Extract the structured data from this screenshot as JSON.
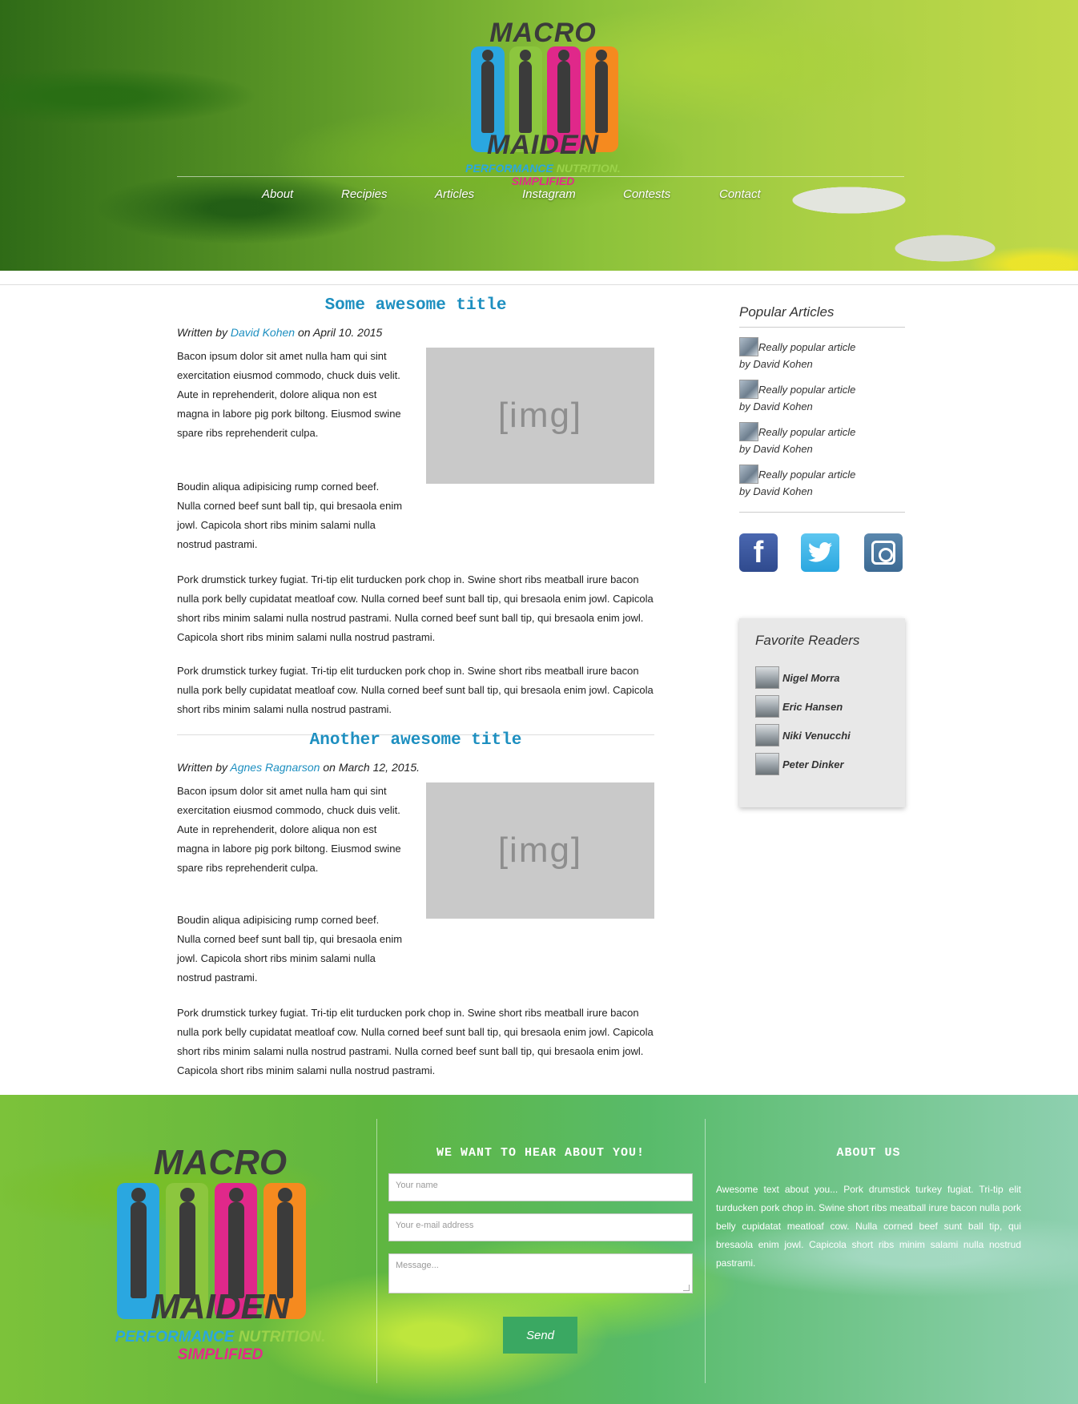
{
  "header": {
    "logo": {
      "word1": "MACRO",
      "word2": "MAIDEN",
      "tag1": "PERFORMANCE",
      "tag2": "NUTRITION.",
      "tag3": "SIMPLIFIED"
    },
    "nav": [
      "About",
      "Recipies",
      "Articles",
      "Instagram",
      "Contests",
      "Contact"
    ]
  },
  "articles": [
    {
      "title": "Some awesome title",
      "written_by": "Written by",
      "author": "David Kohen",
      "date": "on April 10. 2015",
      "img_label": "[img]",
      "para1": "Bacon ipsum dolor sit amet nulla ham qui sint exercitation eiusmod commodo, chuck duis velit. Aute in reprehenderit, dolore aliqua non est magna in labore pig pork biltong. Eiusmod swine spare ribs reprehenderit culpa.",
      "para2": "Boudin aliqua adipisicing rump corned beef. Nulla corned beef sunt ball tip, qui bresaola enim jowl. Capicola short ribs minim salami nulla nostrud pastrami.",
      "para3": "Pork drumstick turkey fugiat. Tri-tip elit turducken pork chop in. Swine short ribs meatball irure bacon nulla pork belly cupidatat meatloaf cow. Nulla corned beef sunt ball tip, qui bresaola enim jowl. Capicola short ribs minim salami nulla nostrud pastrami. Nulla corned beef sunt ball tip, qui bresaola enim jowl. Capicola short ribs minim salami nulla nostrud pastrami.",
      "para4": "Pork drumstick turkey fugiat. Tri-tip elit turducken pork chop in. Swine short ribs meatball irure bacon nulla pork belly cupidatat meatloaf cow. Nulla corned beef sunt ball tip, qui bresaola enim jowl. Capicola short ribs minim salami nulla nostrud pastrami."
    },
    {
      "title": "Another awesome title",
      "written_by": "Written by",
      "author": "Agnes Ragnarson",
      "date": "on March 12, 2015.",
      "img_label": "[img]",
      "para1": "Bacon ipsum dolor sit amet nulla ham qui sint exercitation eiusmod commodo, chuck duis velit. Aute in reprehenderit, dolore aliqua non est magna in labore pig pork biltong. Eiusmod swine spare ribs reprehenderit culpa.",
      "para2": "Boudin aliqua adipisicing rump corned beef. Nulla corned beef sunt ball tip, qui bresaola enim jowl. Capicola short ribs minim salami nulla nostrud pastrami.",
      "para3": "Pork drumstick turkey fugiat. Tri-tip elit turducken pork chop in. Swine short ribs meatball irure bacon nulla pork belly cupidatat meatloaf cow. Nulla corned beef sunt ball tip, qui bresaola enim jowl. Capicola short ribs minim salami nulla nostrud pastrami. Nulla corned beef sunt ball tip, qui bresaola enim jowl. Capicola short ribs minim salami nulla nostrud pastrami."
    }
  ],
  "sidebar": {
    "popular_heading": "Popular Articles",
    "popular": [
      {
        "title": "Really popular article",
        "by": "by David Kohen"
      },
      {
        "title": "Really popular article",
        "by": "by David Kohen"
      },
      {
        "title": "Really popular article",
        "by": "by David Kohen"
      },
      {
        "title": "Really popular article",
        "by": "by David Kohen"
      }
    ],
    "socials": [
      {
        "name": "facebook-icon",
        "glyph": "f"
      },
      {
        "name": "twitter-icon",
        "glyph": "t"
      },
      {
        "name": "instagram-icon",
        "glyph": ""
      }
    ],
    "favorites_heading": "Favorite Readers",
    "readers": [
      "Nigel Morra",
      "Eric Hansen",
      "Niki Venucchi",
      "Peter Dinker"
    ]
  },
  "footer": {
    "contact_heading": "WE WANT TO HEAR ABOUT YOU!",
    "name_placeholder": "Your name",
    "email_placeholder": "Your e-mail address",
    "message_placeholder": "Message...",
    "send_label": "Send",
    "about_heading": "ABOUT US",
    "about_text": "Awesome text about you... Pork drumstick turkey fugiat. Tri-tip elit turducken pork chop in. Swine short ribs meatball irure bacon nulla pork belly cupidatat meatloaf cow. Nulla corned beef sunt ball tip, qui bresaola enim jowl. Capicola short ribs minim salami nulla nostrud pastrami."
  },
  "colors": {
    "link": "#1d8fc0",
    "send_button": "#3aa862"
  }
}
